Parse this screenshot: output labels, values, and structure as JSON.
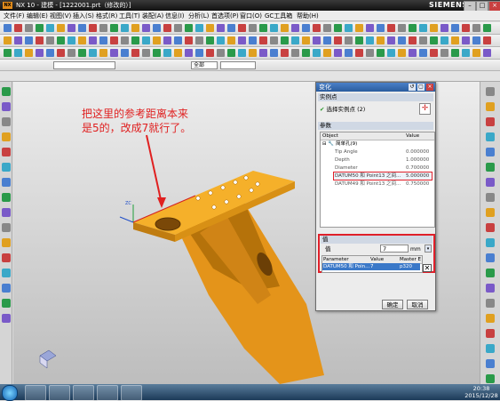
{
  "window": {
    "title": "NX 10 - 建模 - [1222001.prt（修改的）]",
    "brand": "SIEMENS",
    "logo": "NX"
  },
  "menu": [
    "文件(F)",
    "编辑(E)",
    "视图(V)",
    "插入(S)",
    "格式(R)",
    "工具(T)",
    "装配(A)",
    "信息(I)",
    "分析(L)",
    "首选项(P)",
    "窗口(O)",
    "GC工具箱",
    "帮助(H)"
  ],
  "toolbar3": {
    "filter_value": "",
    "scope_value": "全部"
  },
  "annotation": {
    "line1": "把这里的参考距离本来",
    "line2": "是5的，改成7就行了。",
    "color": "#e02020"
  },
  "dialog": {
    "title": "变化",
    "section_instance": "实例点",
    "select_label": "选择实例点 (2)",
    "section_params": "参数",
    "tree_header_object": "Object",
    "tree_header_value": "Value",
    "tree_root": "简单孔(9)",
    "tree_rows": [
      {
        "name": "Tip Angle",
        "value": "0.000000"
      },
      {
        "name": "Depth",
        "value": "1.000000"
      },
      {
        "name": "Diameter",
        "value": "0.700000"
      },
      {
        "name": "DATUM50 和 Point13 之间...",
        "value": "5.000000"
      },
      {
        "name": "DATUM49 和 Point13 之间...",
        "value": "0.750000"
      }
    ],
    "section_value": "值",
    "value_label": "值",
    "value_input": "7",
    "value_unit": "mm",
    "grid_headers": [
      "Parameter",
      "Value",
      "Master E"
    ],
    "grid_row": {
      "parameter": "DATUM50 和 Poin...",
      "value": "7",
      "master": "p320"
    },
    "ok_label": "确定",
    "cancel_label": "取消"
  },
  "taskbar": {
    "time": "20:38",
    "date": "2015/12/28"
  },
  "colors": {
    "part": "#f0a31c",
    "part_dark": "#b5720a",
    "highlight": "#e0202a",
    "dialog_title": "#2a5c9e"
  }
}
